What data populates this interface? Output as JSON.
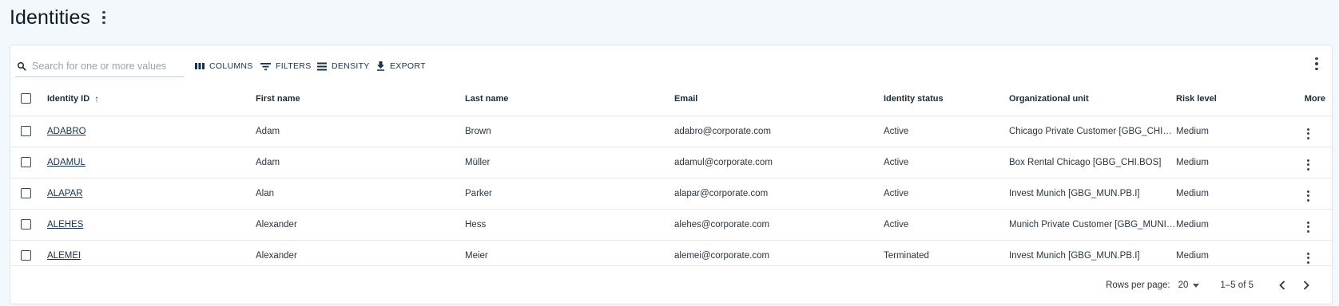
{
  "page": {
    "title": "Identities"
  },
  "toolbar": {
    "search_placeholder": "Search for one or more values",
    "columns_label": "COLUMNS",
    "filters_label": "FILTERS",
    "density_label": "DENSITY",
    "export_label": "EXPORT"
  },
  "table": {
    "headers": {
      "identity_id": "Identity ID",
      "first_name": "First name",
      "last_name": "Last name",
      "email": "Email",
      "identity_status": "Identity status",
      "org_unit": "Organizational unit",
      "risk_level": "Risk level",
      "more": "More"
    },
    "sort": {
      "column": "Identity ID",
      "direction": "ascending"
    },
    "rows": [
      {
        "id": "ADABRO",
        "first": "Adam",
        "last": "Brown",
        "email": "adabro@corporate.com",
        "status": "Active",
        "org": "Chicago Private Customer [GBG_CHIG....",
        "risk": "Medium"
      },
      {
        "id": "ADAMUL",
        "first": "Adam",
        "last": "Müller",
        "email": "adamul@corporate.com",
        "status": "Active",
        "org": "Box Rental Chicago [GBG_CHI.BOS]",
        "risk": "Medium"
      },
      {
        "id": "ALAPAR",
        "first": "Alan",
        "last": "Parker",
        "email": "alapar@corporate.com",
        "status": "Active",
        "org": "Invest Munich [GBG_MUN.PB.I]",
        "risk": "Medium"
      },
      {
        "id": "ALEHES",
        "first": "Alexander",
        "last": "Hess",
        "email": "alehes@corporate.com",
        "status": "Active",
        "org": "Munich Private Customer [GBG_MUNI....",
        "risk": "Medium"
      },
      {
        "id": "ALEMEI",
        "first": "Alexander",
        "last": "Meier",
        "email": "alemei@corporate.com",
        "status": "Terminated",
        "org": "Invest Munich [GBG_MUN.PB.I]",
        "risk": "Medium"
      }
    ]
  },
  "pagination": {
    "rows_per_page_label": "Rows per page:",
    "rows_per_page_value": "20",
    "range": "1–5 of 5"
  },
  "icons": {
    "search": "search-icon",
    "columns": "columns-icon",
    "filters": "filter-icon",
    "density": "density-icon",
    "export": "download-icon",
    "more": "more-vertical-icon",
    "sort": "arrow-up-icon",
    "prev": "chevron-left-icon",
    "next": "chevron-right-icon"
  }
}
